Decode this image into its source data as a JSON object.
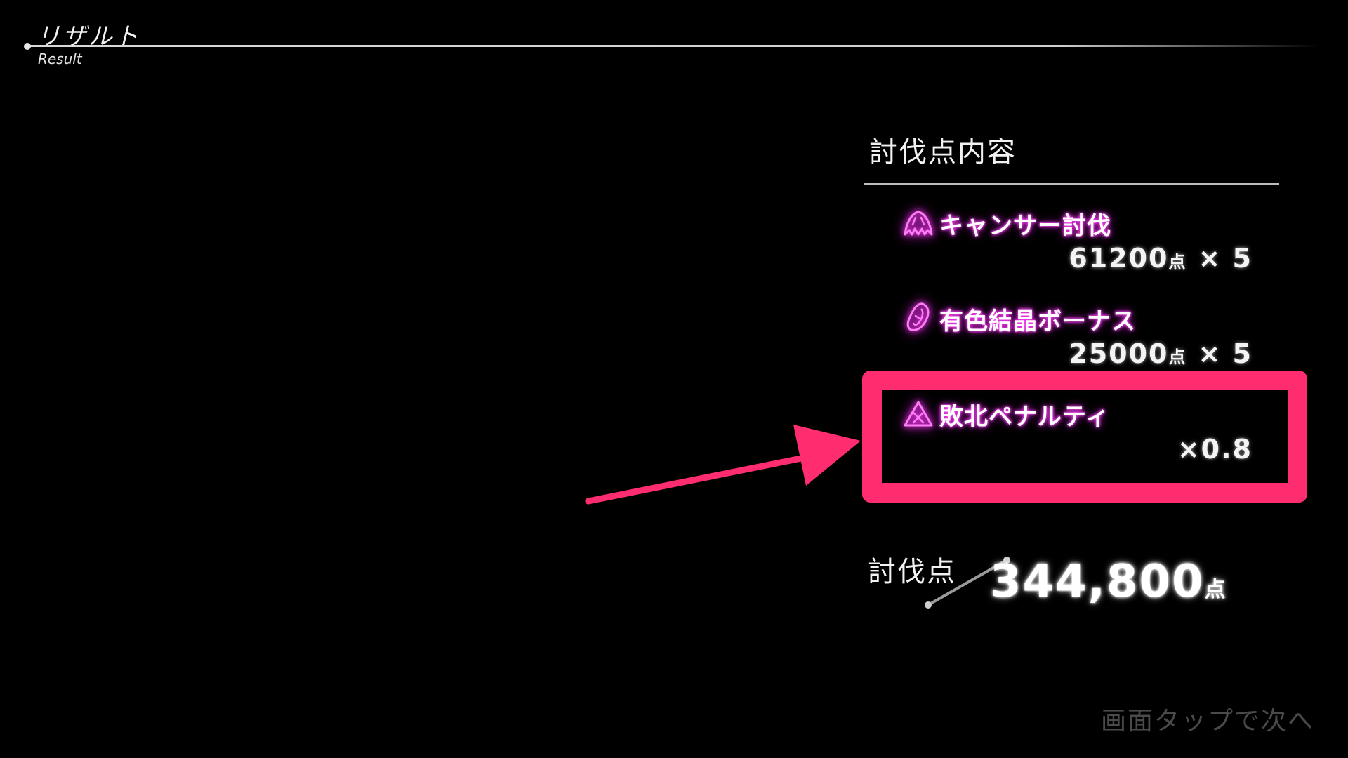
{
  "header": {
    "title": "リザルト",
    "subtitle": "Result"
  },
  "panel": {
    "title": "討伐点内容",
    "items": [
      {
        "icon": "fang-icon",
        "label": "キャンサー討伐",
        "value": "61200",
        "unit": "点",
        "multiplier": "× 5"
      },
      {
        "icon": "crystal-icon",
        "label": "有色結晶ボーナス",
        "value": "25000",
        "unit": "点",
        "multiplier": "× 5"
      },
      {
        "icon": "warning-triangle-icon",
        "label": "敗北ペナルティ",
        "value": "×0.8"
      }
    ]
  },
  "total": {
    "label": "討伐点",
    "value": "344,800",
    "unit": "点"
  },
  "footer": {
    "hint": "画面タップで次へ"
  },
  "colors": {
    "neon_pink": "#ff3df5",
    "highlight": "#ff2d6f",
    "background": "#000000"
  }
}
